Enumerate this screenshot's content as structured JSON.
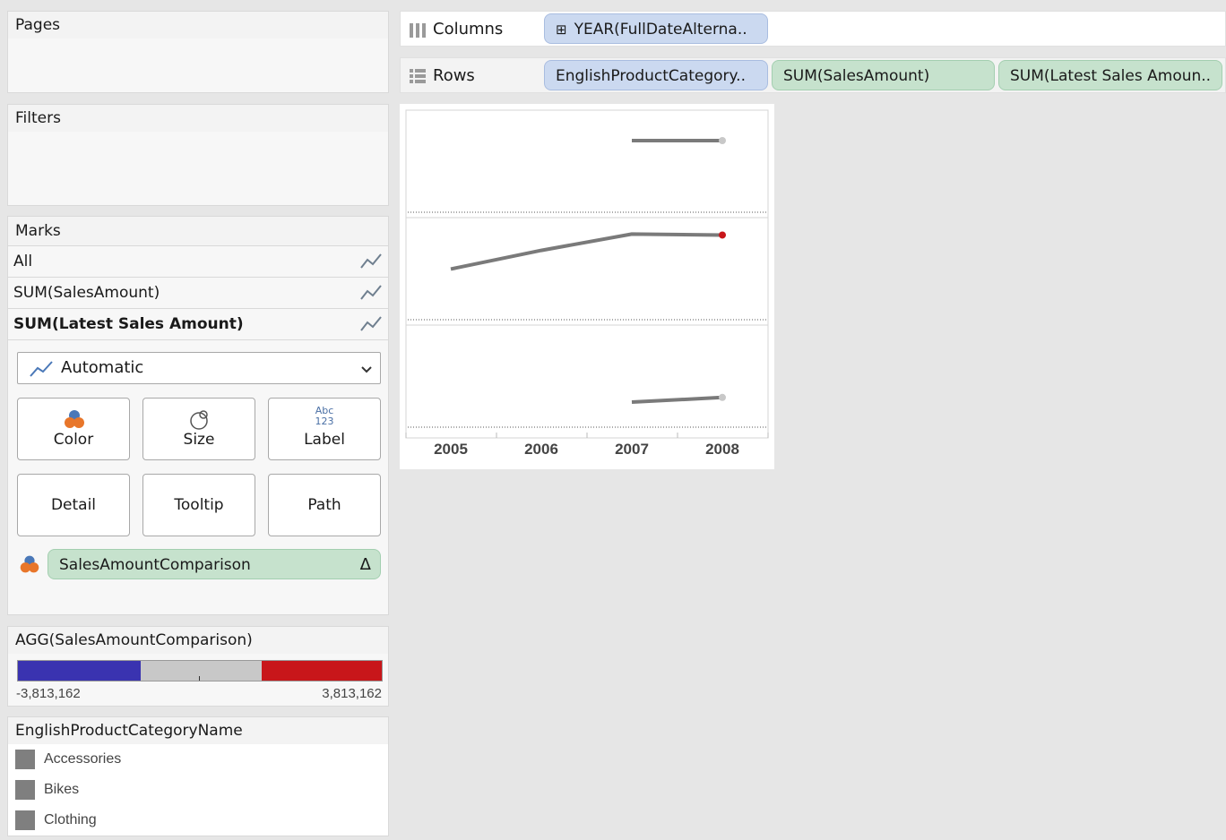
{
  "pages": {
    "title": "Pages"
  },
  "filters": {
    "title": "Filters"
  },
  "marks": {
    "title": "Marks",
    "rows": [
      {
        "label": "All",
        "icon": "line-chart-icon",
        "bold": false
      },
      {
        "label": "SUM(SalesAmount)",
        "icon": "line-chart-icon",
        "bold": false
      },
      {
        "label": "SUM(Latest Sales Amount)",
        "icon": "line-chart-icon",
        "bold": true
      }
    ],
    "mark_type": "Automatic",
    "cards": {
      "color": "Color",
      "size": "Size",
      "label": "Label",
      "label_icon_top": "Abc",
      "label_icon_bottom": "123",
      "detail": "Detail",
      "tooltip": "Tooltip",
      "path": "Path"
    },
    "color_field": "SalesAmountComparison",
    "color_field_badge": "Δ"
  },
  "color_legend": {
    "title": "AGG(SalesAmountComparison)",
    "min_label": "-3,813,162",
    "max_label": "3,813,162",
    "colors": {
      "low": "#3a33b0",
      "mid": "#c8c8c8",
      "high": "#c8161a"
    }
  },
  "category_legend": {
    "title": "EnglishProductCategoryName",
    "items": [
      "Accessories",
      "Bikes",
      "Clothing"
    ],
    "swatch_color": "#7f7f7f"
  },
  "shelves": {
    "columns_label": "Columns",
    "columns_pills": [
      "YEAR(FullDateAlterna.."
    ],
    "columns_pill_prefix": "⊞",
    "rows_label": "Rows",
    "rows_pills": [
      "EnglishProductCategory..",
      "SUM(SalesAmount)",
      "SUM(Latest Sales Amoun.."
    ]
  },
  "chart_data": {
    "type": "line",
    "x": [
      "2005",
      "2006",
      "2007",
      "2008"
    ],
    "panes": [
      {
        "category": "Accessories",
        "sales": [
          null,
          null,
          2,
          2
        ],
        "latest_years": [
          "2007",
          "2008"
        ],
        "reference": 1
      },
      {
        "category": "Bikes",
        "sales": [
          21,
          29,
          36,
          35.6
        ],
        "highlight_last_color": "#c8161a",
        "reference": 0
      },
      {
        "category": "Clothing",
        "sales": [
          null,
          null,
          1,
          1.2
        ],
        "reference": 0
      }
    ]
  }
}
